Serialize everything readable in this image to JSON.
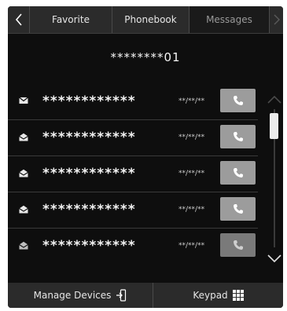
{
  "tabs": {
    "back_icon": "chevron-left-icon",
    "next_icon": "chevron-right-icon",
    "items": [
      {
        "label": "Favorite",
        "active": false
      },
      {
        "label": "Phonebook",
        "active": false
      },
      {
        "label": "Messages",
        "active": true
      }
    ]
  },
  "device": {
    "name": "********01"
  },
  "messages": [
    {
      "contact": "************",
      "date": "**/**/**",
      "read": false
    },
    {
      "contact": "************",
      "date": "**/**/**",
      "read": true
    },
    {
      "contact": "************",
      "date": "**/**/**",
      "read": true
    },
    {
      "contact": "************",
      "date": "**/**/**",
      "read": true
    },
    {
      "contact": "************",
      "date": "**/**/**",
      "read": true
    }
  ],
  "scroll": {
    "up_icon": "chevron-up-icon",
    "down_icon": "chevron-down-icon"
  },
  "footer": {
    "manage_label": "Manage Devices",
    "manage_icon": "manage-devices-icon",
    "keypad_label": "Keypad",
    "keypad_icon": "keypad-grid-icon"
  },
  "colors": {
    "background": "#0e0e0e",
    "bar": "#2b2b2b",
    "call_button": "#9c9c9c",
    "active_tab_text": "#9a9a9a"
  }
}
